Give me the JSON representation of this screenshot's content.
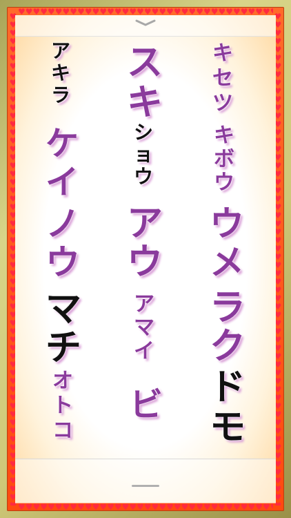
{
  "words": [
    {
      "id": "akira",
      "text": "アキラ",
      "color": "black"
    },
    {
      "id": "suki",
      "text": "スキ",
      "color": "purple"
    },
    {
      "id": "kisetsu",
      "text": "キセツ",
      "color": "purple"
    },
    {
      "id": "kei",
      "text": "ケイ",
      "color": "purple"
    },
    {
      "id": "shou",
      "text": "ショウ",
      "color": "black"
    },
    {
      "id": "kibou",
      "text": "キボウ",
      "color": "purple"
    },
    {
      "id": "nou",
      "text": "ノウ",
      "color": "purple"
    },
    {
      "id": "au",
      "text": "アウ",
      "color": "purple"
    },
    {
      "id": "ume",
      "text": "ウメ",
      "color": "purple"
    },
    {
      "id": "machi",
      "text": "マチ",
      "color": "black"
    },
    {
      "id": "amai",
      "text": "アマイ",
      "color": "purple"
    },
    {
      "id": "raku",
      "text": "ラク",
      "color": "purple"
    },
    {
      "id": "otoko",
      "text": "オトコ",
      "color": "purple"
    },
    {
      "id": "bi",
      "text": "ビ",
      "color": "purple"
    },
    {
      "id": "domo",
      "text": "ドモ",
      "color": "black"
    }
  ],
  "colors": {
    "purple": "#8a3a9c",
    "black": "#111111",
    "frame": "#ff5a20",
    "hearts": "#ff2a40"
  },
  "icons": {
    "top_handle": "chevron-down-icon",
    "bottom_handle": "grab-bar-icon",
    "border": "heart-icon"
  }
}
